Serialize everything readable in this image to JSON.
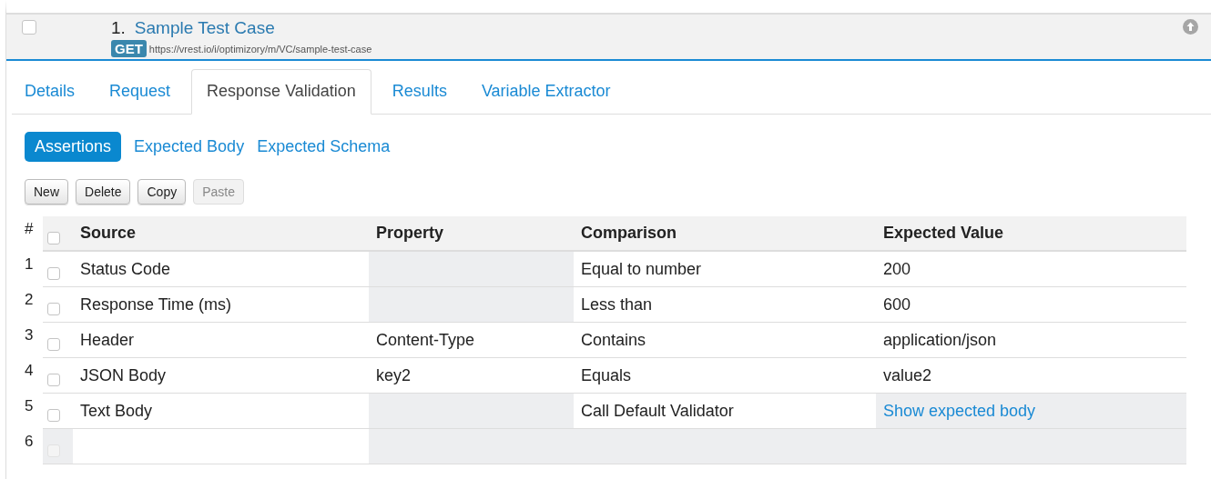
{
  "test_case": {
    "checked": false,
    "number": "1.",
    "title": "Sample Test Case",
    "method": "GET",
    "url": "https://vrest.io/i/optimizory/m/VC/sample-test-case"
  },
  "tabs": [
    {
      "label": "Details",
      "selected": false
    },
    {
      "label": "Request",
      "selected": false
    },
    {
      "label": "Response Validation",
      "selected": true
    },
    {
      "label": "Results",
      "selected": false
    },
    {
      "label": "Variable Extractor",
      "selected": false
    }
  ],
  "subtabs": [
    {
      "label": "Assertions",
      "selected": true
    },
    {
      "label": "Expected Body",
      "selected": false
    },
    {
      "label": "Expected Schema",
      "selected": false
    }
  ],
  "buttons": [
    {
      "label": "New",
      "disabled": false
    },
    {
      "label": "Delete",
      "disabled": false
    },
    {
      "label": "Copy",
      "disabled": false
    },
    {
      "label": "Paste",
      "disabled": true
    }
  ],
  "table": {
    "number_heading": "#",
    "header_checked": false,
    "columns": [
      "Source",
      "Property",
      "Comparison",
      "Expected Value"
    ],
    "rows": [
      {
        "number": "1",
        "checked": false,
        "checkbox_disabled": false,
        "cells": [
          {
            "text": "Status Code",
            "disabled": false
          },
          {
            "disabled": true
          },
          {
            "text": "Equal to number",
            "disabled": false
          },
          {
            "text": "200",
            "disabled": false
          }
        ]
      },
      {
        "number": "2",
        "checked": false,
        "checkbox_disabled": false,
        "cells": [
          {
            "text": "Response Time (ms)",
            "disabled": false
          },
          {
            "disabled": true
          },
          {
            "text": "Less than",
            "disabled": false
          },
          {
            "text": "600",
            "disabled": false
          }
        ]
      },
      {
        "number": "3",
        "checked": false,
        "checkbox_disabled": false,
        "cells": [
          {
            "text": "Header",
            "disabled": false
          },
          {
            "text": "Content-Type",
            "disabled": false
          },
          {
            "text": "Contains",
            "disabled": false
          },
          {
            "text": "application/json",
            "disabled": false
          }
        ]
      },
      {
        "number": "4",
        "checked": false,
        "checkbox_disabled": false,
        "cells": [
          {
            "text": "JSON Body",
            "disabled": false
          },
          {
            "text": "key2",
            "disabled": false
          },
          {
            "text": "Equals",
            "disabled": false
          },
          {
            "text": "value2",
            "disabled": false
          }
        ]
      },
      {
        "number": "5",
        "checked": false,
        "checkbox_disabled": false,
        "cells": [
          {
            "text": "Text Body",
            "disabled": false
          },
          {
            "disabled": true
          },
          {
            "text": "Call Default Validator",
            "disabled": false
          },
          {
            "text": "Show expected body",
            "disabled": true,
            "kind": "link"
          }
        ]
      },
      {
        "number": "6",
        "checked": false,
        "checkbox_disabled": true,
        "cells": [
          {
            "disabled": false
          },
          {
            "disabled": true
          },
          {
            "disabled": true
          },
          {
            "disabled": true
          }
        ]
      }
    ]
  }
}
